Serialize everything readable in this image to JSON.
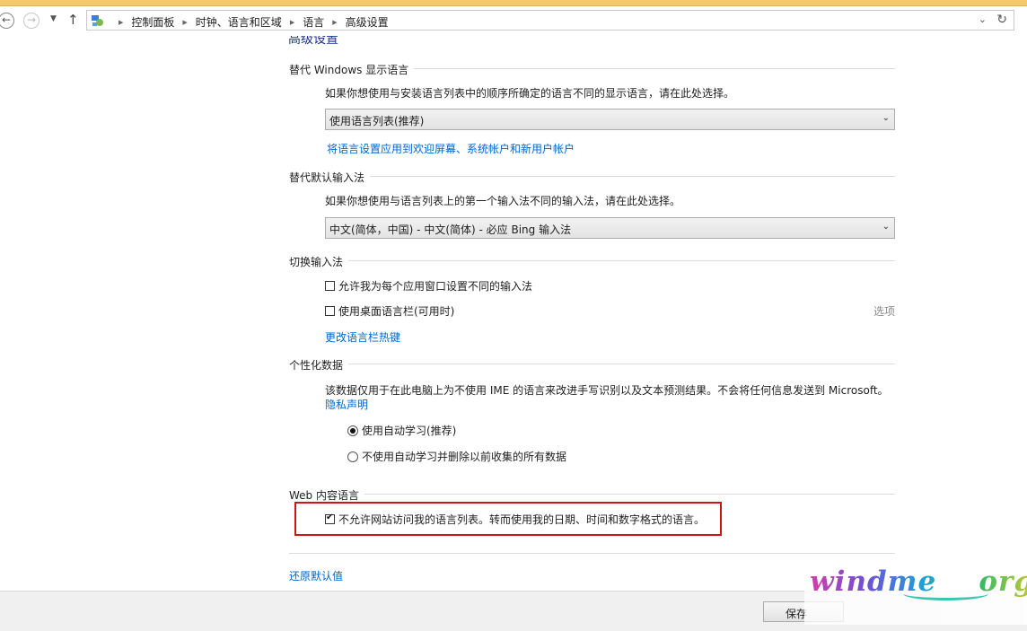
{
  "window_title": "高级设置",
  "nav": {
    "back_icon": "back-arrow-icon",
    "forward_icon": "forward-arrow-icon",
    "up_icon": "up-arrow-icon"
  },
  "breadcrumbs": [
    "控制面板",
    "时钟、语言和区域",
    "语言",
    "高级设置"
  ],
  "page_heading": "高级设置",
  "display_language": {
    "title": "替代 Windows 显示语言",
    "description": "如果你想使用与安装语言列表中的顺序所确定的语言不同的显示语言，请在此处选择。",
    "selected": "使用语言列表(推荐)",
    "link": "将语言设置应用到欢迎屏幕、系统帐户和新用户帐户"
  },
  "input_method": {
    "title": "替代默认输入法",
    "description": "如果你想使用与语言列表上的第一个输入法不同的输入法，请在此处选择。",
    "selected": "中文(简体，中国) - 中文(简体) - 必应 Bing 输入法"
  },
  "switch_input": {
    "title": "切换输入法",
    "option1": "允许我为每个应用窗口设置不同的输入法",
    "option1_checked": false,
    "option2": "使用桌面语言栏(可用时)",
    "option2_checked": false,
    "options_link": "选项",
    "hotkey_link": "更改语言栏热键"
  },
  "personalization": {
    "title": "个性化数据",
    "description": "该数据仅用于在此电脑上为不使用 IME 的语言来改进手写识别以及文本预测结果。不会将任何信息发送到 Microsoft。",
    "privacy_link": "隐私声明",
    "radio1": "使用自动学习(推荐)",
    "radio2": "不使用自动学习并删除以前收集的所有数据",
    "selected": "radio1"
  },
  "web_language": {
    "title": "Web 内容语言",
    "checkbox": "不允许网站访问我的语言列表。转而使用我的日期、时间和数字格式的语言。",
    "checked": true
  },
  "restore_link": "还原默认值",
  "save_button": "保存",
  "watermark": "windme org",
  "colors": {
    "link": "#0066cc",
    "highlight_border": "#cc1616",
    "title_bar": "#f4c96a"
  }
}
